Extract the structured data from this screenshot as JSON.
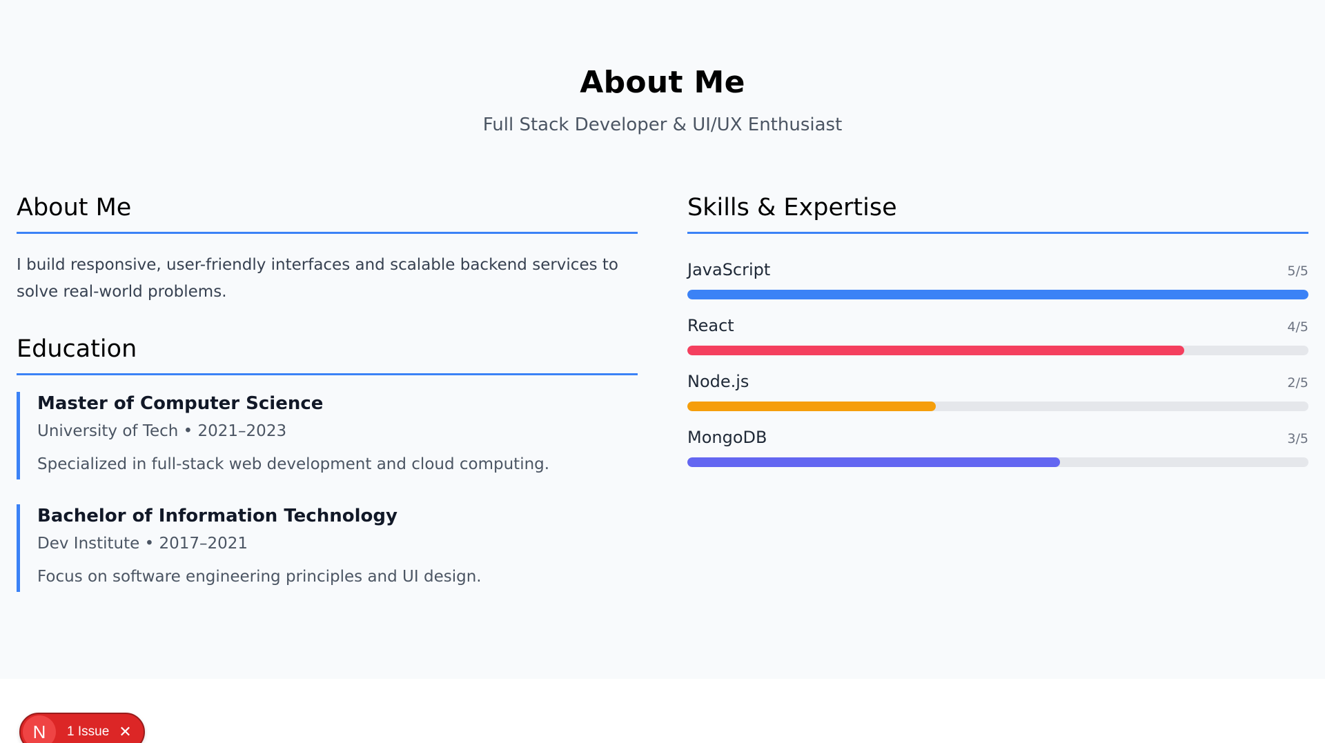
{
  "hero": {
    "title": "About Me",
    "subtitle": "Full Stack Developer & UI/UX Enthusiast"
  },
  "about": {
    "heading": "About Me",
    "text": "I build responsive, user-friendly interfaces and scalable backend services to solve real-world problems."
  },
  "education": {
    "heading": "Education",
    "items": [
      {
        "degree": "Master of Computer Science",
        "meta": "University of Tech • 2021–2023",
        "description": "Specialized in full-stack web development and cloud computing."
      },
      {
        "degree": "Bachelor of Information Technology",
        "meta": "Dev Institute • 2017–2021",
        "description": "Focus on software engineering principles and UI design."
      }
    ]
  },
  "skills": {
    "heading": "Skills & Expertise",
    "items": [
      {
        "name": "JavaScript",
        "level_text": "5/5",
        "level": 5,
        "max": 5,
        "color": "#3b82f6"
      },
      {
        "name": "React",
        "level_text": "4/5",
        "level": 4,
        "max": 5,
        "color": "#f43f5e"
      },
      {
        "name": "Node.js",
        "level_text": "2/5",
        "level": 2,
        "max": 5,
        "color": "#f59e0b"
      },
      {
        "name": "MongoDB",
        "level_text": "3/5",
        "level": 3,
        "max": 5,
        "color": "#6366f1"
      }
    ]
  },
  "dev_overlay": {
    "logo_letter": "N",
    "label": "1 Issue",
    "close_icon": "close-icon",
    "color": "#dc2626"
  }
}
